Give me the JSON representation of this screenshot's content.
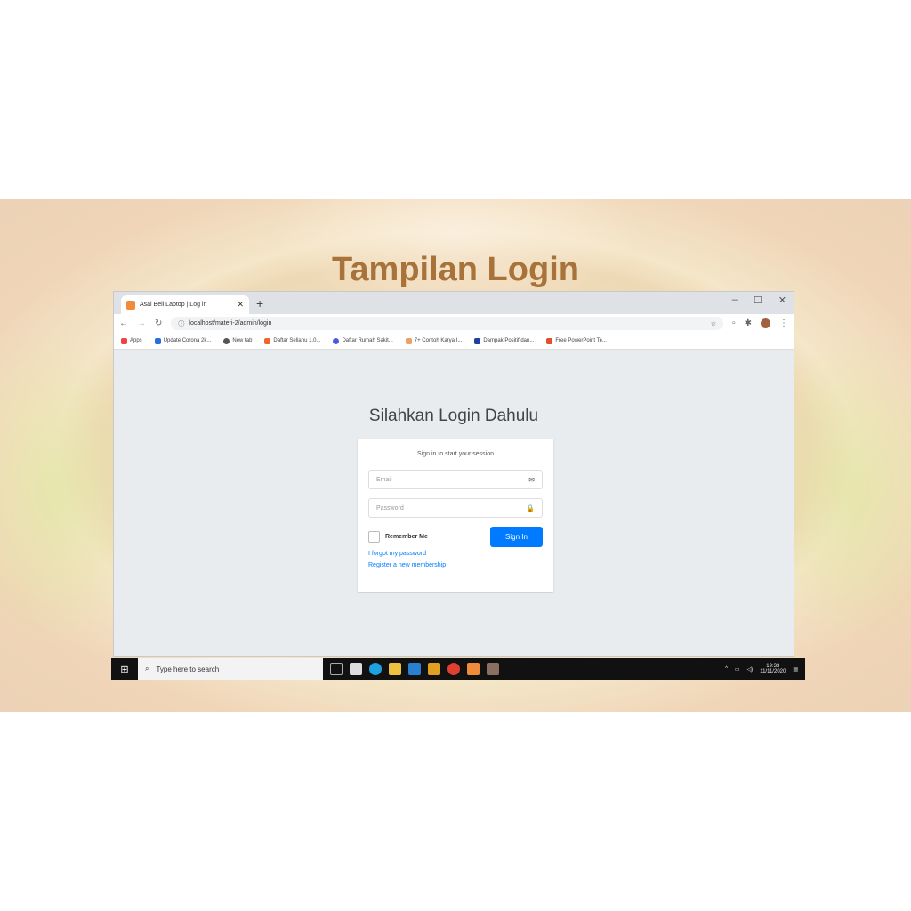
{
  "slide": {
    "title": "Tampilan Login"
  },
  "browser": {
    "tab_title": "Asal Beli Laptop | Log in",
    "url": "localhost/materi-2/admin/login",
    "bookmarks": [
      "Apps",
      "Update Corona 2k...",
      "New tab",
      "Daftar Sellanu 1.0...",
      "Daftar Rumah Sakit...",
      "7+ Contoh Karya I...",
      "Dampak Positif dan...",
      "Free PowerPoint Te..."
    ]
  },
  "page": {
    "heading": "Silahkan Login Dahulu",
    "message": "Sign in to start your session",
    "email_placeholder": "Email",
    "password_placeholder": "Password",
    "remember_label": "Remember Me",
    "signin_label": "Sign In",
    "forgot_link": "I forgot my password",
    "register_link": "Register a new membership"
  },
  "taskbar": {
    "search_placeholder": "Type here to search",
    "time": "19:33",
    "date": "11/11/2020"
  },
  "colors": {
    "accent": "#007bff",
    "title": "#a7733a"
  }
}
